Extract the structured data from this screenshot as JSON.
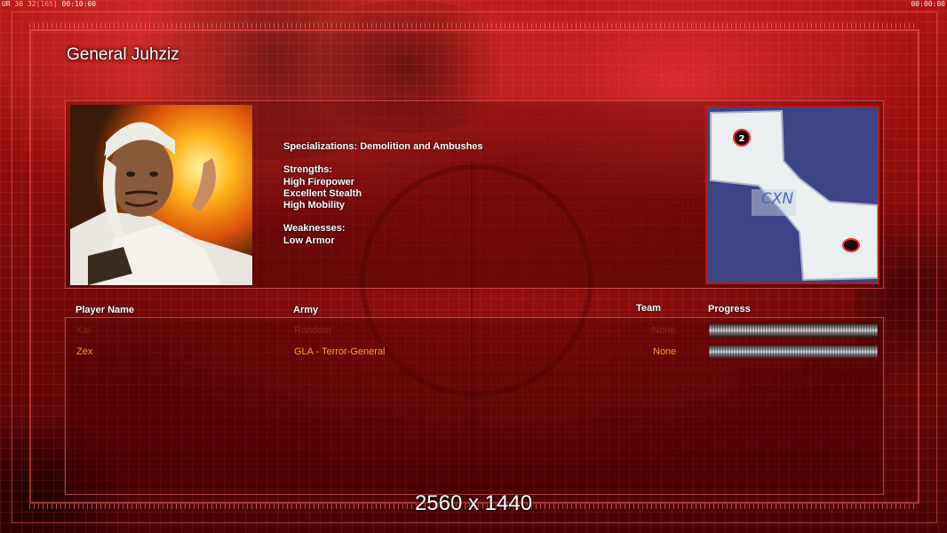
{
  "hud": {
    "left_prefix": "UR",
    "left_fps": "30",
    "left_frames": "32",
    "left_bracket": "[165]",
    "left_time": "00:10:00",
    "right_time": "00:00:00"
  },
  "general": {
    "name": "General Juhziz",
    "specializations": "Specializations: Demolition and Ambushes",
    "strengths_title": "Strengths:",
    "strengths": [
      "High Firepower",
      "Excellent Stealth",
      "High Mobility"
    ],
    "weaknesses_title": "Weaknesses:",
    "weaknesses": [
      "Low Armor"
    ]
  },
  "map": {
    "start_marker_1": "2",
    "center_label": "CXN"
  },
  "table": {
    "headers": {
      "player_name": "Player Name",
      "army": "Army",
      "team": "Team",
      "progress": "Progress"
    },
    "rows": [
      {
        "player_name": "Kai",
        "army": "Random",
        "team": "None",
        "progress": 1.0
      },
      {
        "player_name": "Zex",
        "army": "GLA - Terror-General",
        "team": "None",
        "progress": 1.0
      }
    ]
  },
  "resolution_label": "2560 x 1440",
  "colors": {
    "accent_red": "#c01818",
    "row_text_active": "#ff9c3a",
    "map_water": "#3c4486",
    "map_land": "#eceff0"
  }
}
